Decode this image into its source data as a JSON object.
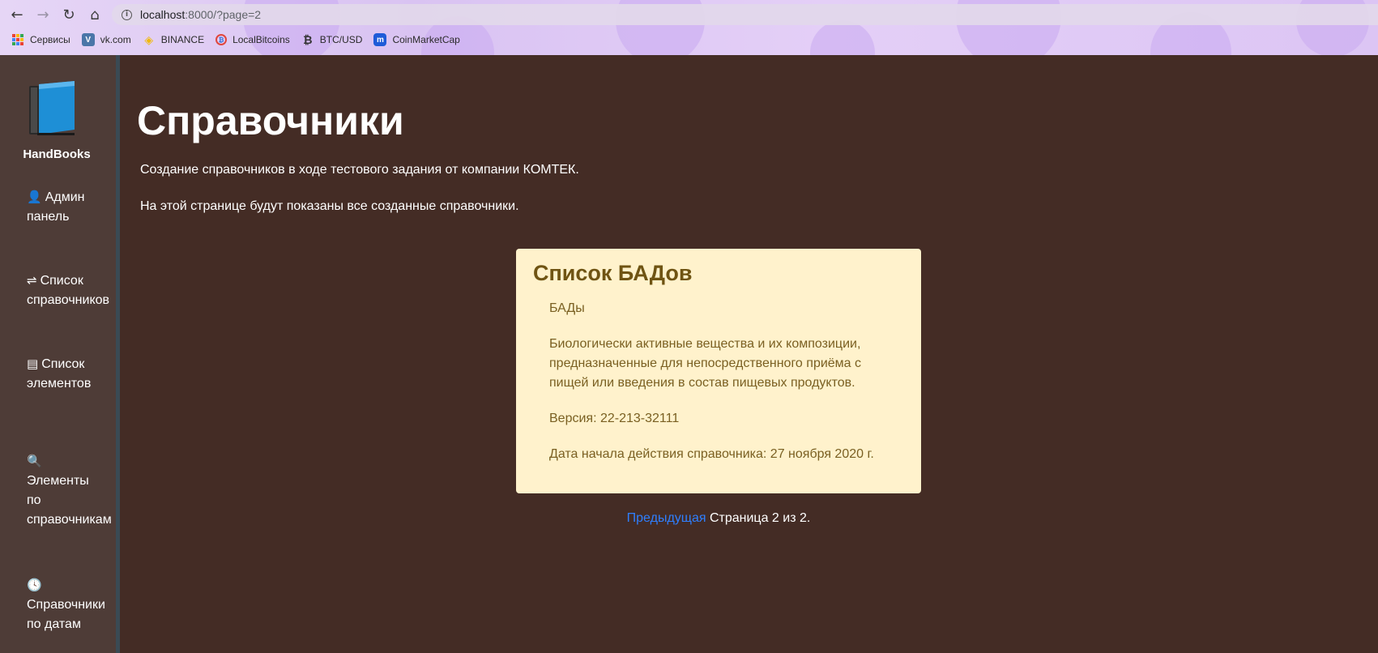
{
  "browser": {
    "url_host": "localhost",
    "url_rest": ":8000/?page=2",
    "bookmarks": [
      {
        "label": "Сервисы",
        "icon": "apps-grid-icon"
      },
      {
        "label": "vk.com",
        "icon": "vk-icon"
      },
      {
        "label": "BINANCE",
        "icon": "binance-icon"
      },
      {
        "label": "LocalBitcoins",
        "icon": "localbitcoins-icon"
      },
      {
        "label": "BTC/USD",
        "icon": "bitcoin-icon"
      },
      {
        "label": "CoinMarketCap",
        "icon": "coinmarketcap-icon"
      }
    ]
  },
  "sidebar": {
    "brand": "HandBooks",
    "items": [
      {
        "line1": "Админ",
        "line2": "панель",
        "icon": "user-cog-icon"
      },
      {
        "line1": "Список",
        "line2": "справочников",
        "icon": "signs-icon"
      },
      {
        "line1": "Список",
        "line2": "элементов",
        "icon": "list-icon"
      },
      {
        "line1": "Элементы",
        "line2": "по",
        "line3": "справочникам",
        "icon": "search-icon"
      },
      {
        "line1": "Справочники",
        "line2": "по датам",
        "icon": "clock-icon"
      }
    ]
  },
  "main": {
    "title": "Справочники",
    "intro1": "Создание справочников в ходе тестового задания от компании КОМТЕК.",
    "intro2": "На этой странице будут показаны все созданные справочники.",
    "card": {
      "title": "Список БАДов",
      "short_name": "БАДы",
      "description": "Биологически активные вещества и их композиции, предназначенные для непосредственного приёма с пищей или введения в состав пищевых продуктов.",
      "version": "Версия: 22-213-32111",
      "start_date": "Дата начала действия справочника: 27 ноября 2020 г."
    },
    "pager": {
      "prev_label": "Предыдущая",
      "status": "Страница 2 из 2."
    }
  },
  "colors": {
    "page_bg": "#442c25",
    "sidebar_bg": "#4e3c37",
    "card_bg": "#fff2cc",
    "card_text": "#7a5c12",
    "link": "#2f7fff"
  }
}
